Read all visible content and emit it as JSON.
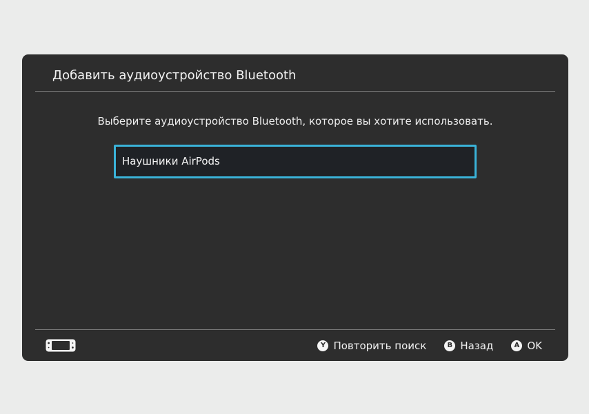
{
  "dialog": {
    "title": "Добавить аудиоустройство Bluetooth",
    "instruction": "Выберите аудиоустройство Bluetooth, которое вы хотите использовать.",
    "devices": [
      {
        "label": "Наушники AirPods",
        "selected": true
      }
    ]
  },
  "footer": {
    "console_icon": "switch-console-icon",
    "hints": [
      {
        "glyph": "Y",
        "label": "Повторить поиск"
      },
      {
        "glyph": "B",
        "label": "Назад"
      },
      {
        "glyph": "A",
        "label": "OK"
      }
    ]
  },
  "colors": {
    "background": "#ebeceb",
    "panel": "#2d2d2d",
    "accent": "#3ab3d9"
  }
}
